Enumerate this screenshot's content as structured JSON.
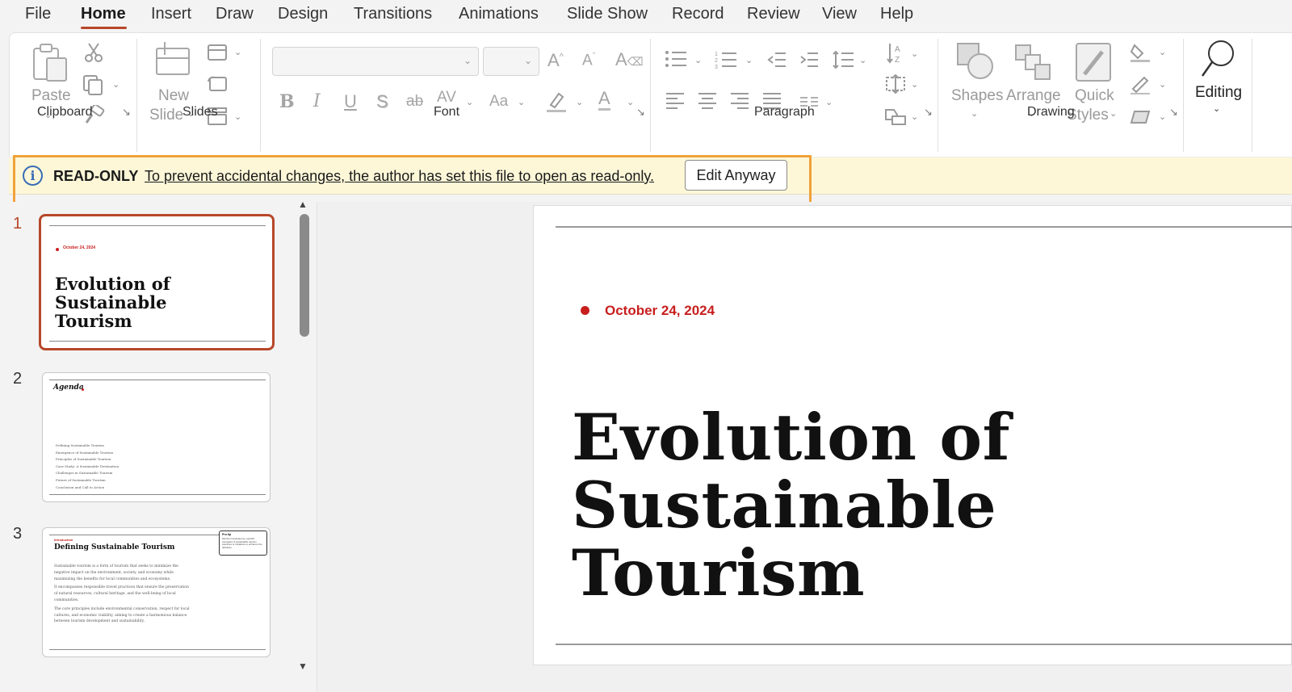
{
  "menu": {
    "items": [
      "File",
      "Home",
      "Insert",
      "Draw",
      "Design",
      "Transitions",
      "Animations",
      "Slide Show",
      "Record",
      "Review",
      "View",
      "Help"
    ],
    "active": "Home"
  },
  "ribbon": {
    "clipboard": {
      "label": "Clipboard",
      "paste": "Paste"
    },
    "slides": {
      "label": "Slides",
      "new_slide_line1": "New",
      "new_slide_line2": "Slide"
    },
    "font": {
      "label": "Font",
      "case_label": "Aa",
      "spacing_label": "AV"
    },
    "paragraph": {
      "label": "Paragraph"
    },
    "drawing": {
      "label": "Drawing",
      "shapes": "Shapes",
      "arrange": "Arrange",
      "quick_line1": "Quick",
      "quick_line2": "Styles"
    },
    "editing": {
      "label": "Editing"
    }
  },
  "banner": {
    "title": "READ-ONLY",
    "message": "To prevent accidental changes, the author has set this file to open as read-only.",
    "button": "Edit Anyway"
  },
  "thumbnails": [
    {
      "number": "1",
      "date": "October 24, 2024",
      "title_lines": [
        "Evolution of",
        "Sustainable",
        "Tourism"
      ]
    },
    {
      "number": "2",
      "title": "Agenda",
      "items": [
        "Defining Sustainable Tourism",
        "Emergence of Sustainable Tourism",
        "Principles of Sustainable Tourism",
        "Case Study: A Sustainable Destination",
        "Challenges in Sustainable Tourism",
        "Future of Sustainable Tourism",
        "Conclusion and Call to Action"
      ]
    },
    {
      "number": "3",
      "kicker": "Introduction",
      "title": "Defining Sustainable Tourism",
      "tip_title": "Pro tip",
      "tip_body": "Mention transparency, specific examples of sustainable tourism practices or initiatives to enhance the definition.",
      "paragraphs": [
        "Sustainable tourism is a form of tourism that seeks to minimize the negative impact on the environment, society, and economy while maximizing the benefits for local communities and ecosystems.",
        "It encompasses responsible travel practices that ensure the preservation of natural resources, cultural heritage, and the well-being of local communities.",
        "The core principles include environmental conservation, respect for local cultures, and economic viability, aiming to create a harmonious balance between tourism development and sustainability."
      ]
    }
  ],
  "slide": {
    "date": "October 24, 2024",
    "title_lines": [
      "Evolution of",
      "Sustainable",
      "Tourism"
    ]
  },
  "colors": {
    "accent": "#b7472a",
    "date_red": "#c81e1e",
    "banner_bg": "#fdf7d8",
    "highlight_outline": "#f0a23a"
  }
}
